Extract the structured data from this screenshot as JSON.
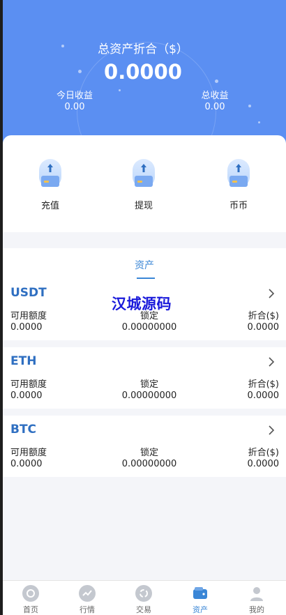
{
  "header": {
    "title": "总资产折合（$）",
    "total": "0.0000",
    "today_label": "今日收益",
    "today_value": "0.00",
    "total_label": "总收益",
    "total_value": "0.00"
  },
  "actions": [
    {
      "label": "充值",
      "icon": "deposit-icon"
    },
    {
      "label": "提现",
      "icon": "withdraw-icon"
    },
    {
      "label": "币币",
      "icon": "coin-icon"
    }
  ],
  "asset_tab": {
    "label": "资产"
  },
  "watermark": "汉城源码",
  "coins": [
    {
      "name": "USDT",
      "available_label": "可用额度",
      "locked_label": "锁定",
      "convert_label": "折合($)",
      "available": "0.0000",
      "locked": "0.00000000",
      "convert": "0.0000"
    },
    {
      "name": "ETH",
      "available_label": "可用额度",
      "locked_label": "锁定",
      "convert_label": "折合($)",
      "available": "0.0000",
      "locked": "0.00000000",
      "convert": "0.0000"
    },
    {
      "name": "BTC",
      "available_label": "可用额度",
      "locked_label": "锁定",
      "convert_label": "折合($)",
      "available": "0.0000",
      "locked": "0.00000000",
      "convert": "0.0000"
    }
  ],
  "nav": [
    {
      "label": "首页",
      "icon": "home-icon"
    },
    {
      "label": "行情",
      "icon": "market-icon"
    },
    {
      "label": "交易",
      "icon": "trade-icon"
    },
    {
      "label": "资产",
      "icon": "wallet-icon",
      "active": true
    },
    {
      "label": "我的",
      "icon": "profile-icon"
    }
  ],
  "colors": {
    "accent": "#3a86d6",
    "hero": "#5b8ff2"
  }
}
